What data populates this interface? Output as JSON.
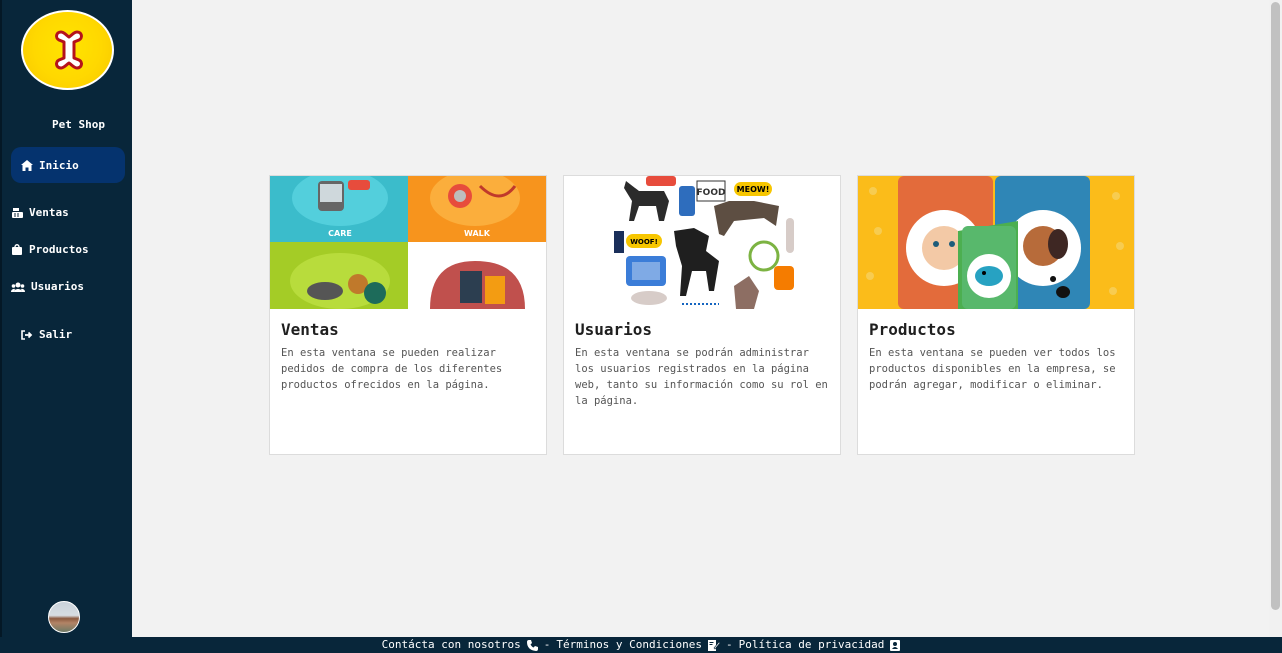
{
  "sidebar": {
    "brand": "Pet Shop",
    "items": [
      {
        "label": "Inicio",
        "icon": "home-icon",
        "active": true
      },
      {
        "label": "Ventas",
        "icon": "cash-register-icon"
      },
      {
        "label": "Productos",
        "icon": "shopping-bag-icon"
      },
      {
        "label": "Usuarios",
        "icon": "users-icon"
      },
      {
        "label": "Salir",
        "icon": "sign-out-icon"
      }
    ]
  },
  "cards": [
    {
      "title": "Ventas",
      "description": "En esta ventana se pueden realizar pedidos de compra de los diferentes productos ofrecidos en la página.",
      "image_labels": [
        "CARE",
        "WALK"
      ]
    },
    {
      "title": "Usuarios",
      "description": "En esta ventana se podrán administrar los usuarios registrados en la página web, tanto su información como su rol en la página.",
      "image_labels": [
        "FOOD",
        "MEOW!",
        "WOOF!"
      ]
    },
    {
      "title": "Productos",
      "description": "En esta ventana se pueden ver todos los productos disponibles en la empresa, se podrán agregar, modificar o eliminar."
    }
  ],
  "footer": {
    "contact": "Contácta con nosotros",
    "sep1": "-",
    "terms": "Términos y Condiciones",
    "sep2": "-",
    "privacy": "Política de privacidad"
  },
  "colors": {
    "sidebar_bg": "#08263a",
    "active_item_bg": "#05336e",
    "logo_yellow": "#ffd800",
    "page_bg": "#f2f2f2"
  }
}
